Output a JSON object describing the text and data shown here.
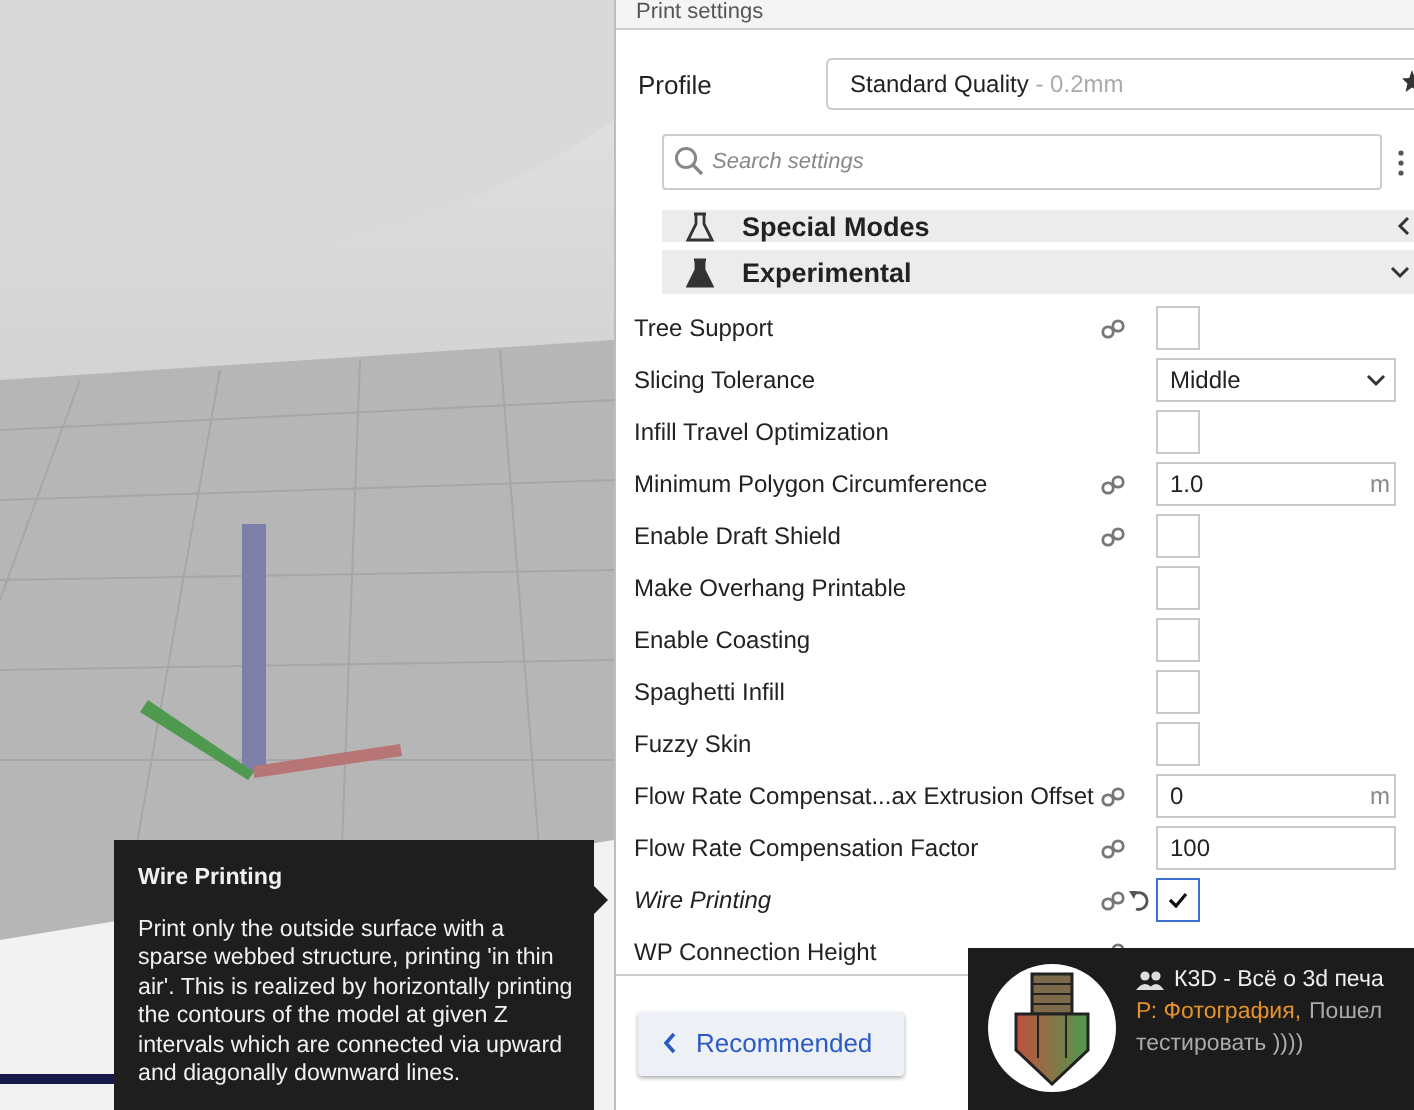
{
  "panel": {
    "title": "Print settings",
    "profile": {
      "label": "Profile",
      "name": "Standard Quality",
      "detail": " - 0.2mm"
    },
    "search": {
      "placeholder": "Search settings"
    },
    "categories": [
      {
        "label": "Special Modes",
        "expanded": false
      },
      {
        "label": "Experimental",
        "expanded": true
      }
    ],
    "settings": [
      {
        "label": "Tree Support",
        "kind": "checkbox",
        "linked": true,
        "modified": false,
        "checked": false
      },
      {
        "label": "Slicing Tolerance",
        "kind": "dropdown",
        "linked": false,
        "modified": false,
        "value": "Middle"
      },
      {
        "label": "Infill Travel Optimization",
        "kind": "checkbox",
        "linked": false,
        "modified": false,
        "checked": false
      },
      {
        "label": "Minimum Polygon Circumference",
        "kind": "number",
        "linked": true,
        "modified": false,
        "value": "1.0",
        "unit": "m"
      },
      {
        "label": "Enable Draft Shield",
        "kind": "checkbox",
        "linked": true,
        "modified": false,
        "checked": false
      },
      {
        "label": "Make Overhang Printable",
        "kind": "checkbox",
        "linked": false,
        "modified": false,
        "checked": false
      },
      {
        "label": "Enable Coasting",
        "kind": "checkbox",
        "linked": false,
        "modified": false,
        "checked": false
      },
      {
        "label": "Spaghetti Infill",
        "kind": "checkbox",
        "linked": false,
        "modified": false,
        "checked": false
      },
      {
        "label": "Fuzzy Skin",
        "kind": "checkbox",
        "linked": false,
        "modified": false,
        "checked": false
      },
      {
        "label": "Flow Rate Compensat...ax Extrusion Offset",
        "kind": "number",
        "linked": true,
        "modified": false,
        "value": "0",
        "unit": "m"
      },
      {
        "label": "Flow Rate Compensation Factor",
        "kind": "number",
        "linked": true,
        "modified": false,
        "value": "100"
      },
      {
        "label": "Wire Printing",
        "kind": "checkbox",
        "linked": true,
        "modified": true,
        "checked": true
      },
      {
        "label": "WP Connection Height",
        "kind": "hidden",
        "linked": true,
        "modified": false
      }
    ],
    "footer": {
      "button": "Recommended"
    }
  },
  "tooltip": {
    "title": "Wire Printing",
    "text": "Print only the outside surface with a sparse webbed structure, printing 'in thin air'. This is realized by horizontally printing the contours of the model at given Z intervals which are connected via upward and diagonally downward lines."
  },
  "notification": {
    "title": "К3D - Всё о 3d печа",
    "sender": "Р: Фотография,",
    "line_1": "Пошел",
    "line_2": "тестировать ))))"
  }
}
